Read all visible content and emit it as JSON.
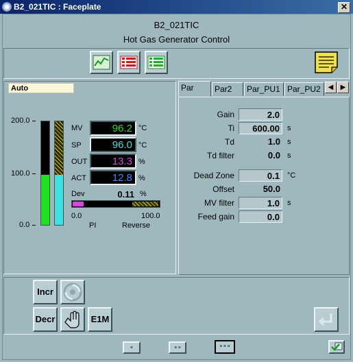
{
  "window": {
    "title": "B2_021TIC : Faceplate",
    "close_label": "✕"
  },
  "header": {
    "tag": "B2_021TIC",
    "description": "Hot Gas Generator Control"
  },
  "mode": {
    "value": "Auto"
  },
  "scale": {
    "max": "200.0",
    "mid": "100.0",
    "min": "0.0"
  },
  "process": {
    "mv": {
      "label": "MV",
      "value": "96.2",
      "unit": "°C"
    },
    "sp": {
      "label": "SP",
      "value": "96.0",
      "unit": "°C"
    },
    "out": {
      "label": "OUT",
      "value": "13.3",
      "unit": "%"
    },
    "act": {
      "label": "ACT",
      "value": "12.8",
      "unit": "%"
    },
    "dev": {
      "label": "Dev",
      "value": "0.11",
      "unit": "%"
    },
    "dev_scale_min": "0.0",
    "dev_scale_max": "100.0",
    "controller_type": "PI",
    "direction": "Reverse",
    "mv_fraction": 0.481,
    "out_fraction": 0.133
  },
  "tabs": [
    {
      "label": "Par"
    },
    {
      "label": "Par2"
    },
    {
      "label": "Par_PU1"
    },
    {
      "label": "Par_PU2"
    }
  ],
  "params": {
    "gain": {
      "label": "Gain",
      "value": "2.0",
      "unit": ""
    },
    "ti": {
      "label": "Ti",
      "value": "600.00",
      "unit": "s"
    },
    "td": {
      "label": "Td",
      "value": "1.0",
      "unit": "s"
    },
    "td_filter": {
      "label": "Td filter",
      "value": "0.0",
      "unit": "s"
    },
    "dead_zone": {
      "label": "Dead Zone",
      "value": "0.1",
      "unit": "°C"
    },
    "offset": {
      "label": "Offset",
      "value": "50.0",
      "unit": ""
    },
    "mv_filter": {
      "label": "MV filter",
      "value": "1.0",
      "unit": "s"
    },
    "feed_gain": {
      "label": "Feed gain",
      "value": "0.0",
      "unit": ""
    }
  },
  "buttons": {
    "incr": "Incr",
    "decr": "Decr",
    "e1m": "E1M"
  },
  "colors": {
    "mv": "#22e022",
    "sp": "#40e0e0",
    "out": "#e040e0",
    "act": "#3a8cff",
    "note": "#f2e24a"
  }
}
